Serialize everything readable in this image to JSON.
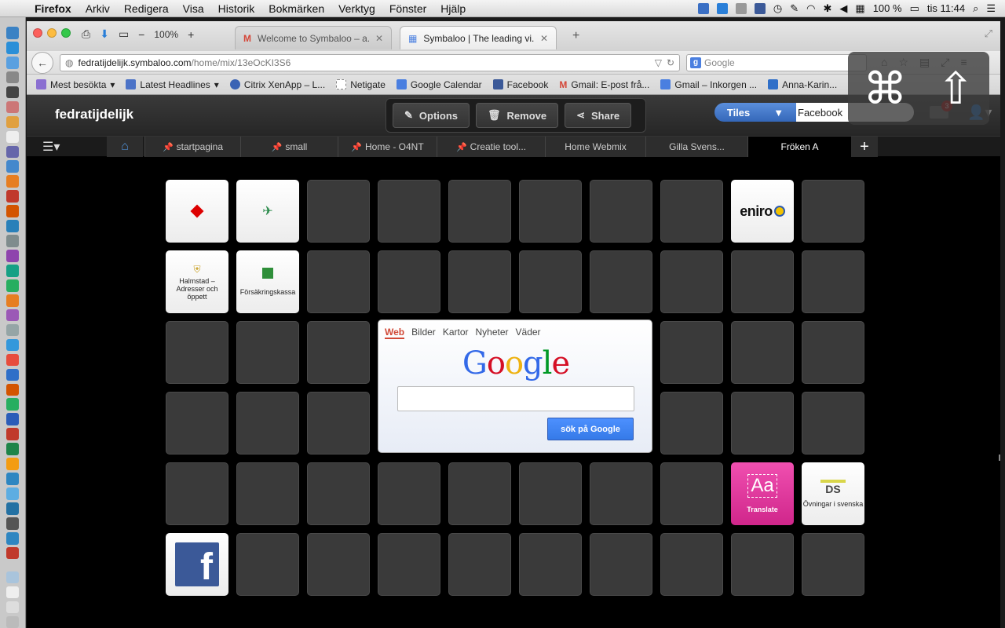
{
  "menubar": {
    "app": "Firefox",
    "menus": [
      "Arkiv",
      "Redigera",
      "Visa",
      "Historik",
      "Bokmärken",
      "Verktyg",
      "Fönster",
      "Hjälp"
    ],
    "battery": "100 %",
    "clock": "tis 11:44"
  },
  "browser": {
    "zoom": "100%",
    "tabs": [
      {
        "title": "Welcome to Symbaloo – a..."
      },
      {
        "title": "Symbaloo | The leading vi..."
      }
    ],
    "url_host": "fedratijdelijk.symbaloo.com",
    "url_path": "/home/mix/13eOcKI3S6",
    "search_placeholder": "Google",
    "bookmarks": [
      {
        "label": "Mest besökta",
        "color": "#8a6fd1"
      },
      {
        "label": "Latest Headlines",
        "color": "#4c73c7"
      },
      {
        "label": "Citrix XenApp – L...",
        "color": "#3b63b4"
      },
      {
        "label": "Netigate",
        "color": "#ffffff"
      },
      {
        "label": "Google Calendar",
        "color": "#4a7fe0"
      },
      {
        "label": "Facebook",
        "color": "#3b5998"
      },
      {
        "label": "Gmail: E-post frå...",
        "color": "#d44638"
      },
      {
        "label": "Gmail – Inkorgen ...",
        "color": "#4a7fe0"
      },
      {
        "label": "Anna-Karin...",
        "color": "#2f6fc8"
      }
    ]
  },
  "symbaloo": {
    "logo": "fedratijdelijk",
    "options": "Options",
    "remove": "Remove",
    "share": "Share",
    "tiles_selector": "Tiles",
    "search_source": "Facebook",
    "mail_count": "3",
    "tabs": [
      "startpagina",
      "small",
      "Home - O4NT",
      "Creatie tool...",
      "Home Webmix",
      "Gilla Svens...",
      "Fröken A"
    ],
    "tiles": {
      "halmstad": "Halmstad – Adresser och öppett",
      "forsakring": "Försäkringskassa",
      "eniro": "eniro",
      "translate_mark": "Aa",
      "translate": "Translate",
      "ds_mark": "DS",
      "ovningar": "Övningar i svenska",
      "facebook_mark": "f"
    },
    "google_widget": {
      "tabs": [
        "Web",
        "Bilder",
        "Kartor",
        "Nyheter",
        "Väder"
      ],
      "logo": "Google",
      "button": "sök på Google"
    }
  },
  "overlay": {
    "command_symbol": "⌘",
    "shift_symbol": "⇧"
  }
}
